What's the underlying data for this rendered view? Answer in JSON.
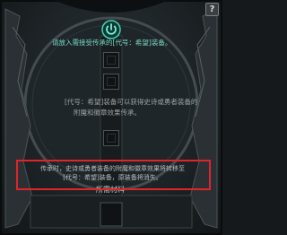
{
  "window": {
    "help_label": "?"
  },
  "panel": {
    "instruction": "请放入需接受传承的[代号：希望]装备。",
    "description": {
      "line1": "[代号：希望]装备可以获得史诗或勇者装备的",
      "line2": "附魔和徽章效果传承。"
    },
    "footer": {
      "line1": "传承时，史诗或勇者装备的附魔和徽章效果将转移至",
      "line2": "[代号：希望]装备，原装备将消失。"
    },
    "material_label": "所需材料"
  },
  "icons": {
    "power": "power-icon",
    "help": "question-mark-icon"
  },
  "colors": {
    "accent_teal": "#78d6c6",
    "highlight_red": "#e0242a"
  }
}
